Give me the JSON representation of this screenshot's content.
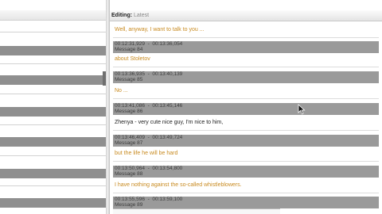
{
  "editor": {
    "header_label": "Editing:",
    "header_value": "Latest"
  },
  "lines": [
    {
      "text": "Well, anyway, I want to talk to you ..."
    },
    {
      "text": "about Stoletov"
    },
    {
      "text": "No ..."
    },
    {
      "text": "Zhenya - very cute nice guy, I'm nice to him,"
    },
    {
      "text": "but the life he will be hard"
    },
    {
      "text": "I have nothing against the so-called whistleblowers."
    }
  ],
  "entries": [
    {
      "start": "00:12:31,929",
      "end": "00:13:36,054",
      "message": "Message 84"
    },
    {
      "start": "00:13:36,935",
      "end": "00:13:40,139",
      "message": "Message 85"
    },
    {
      "start": "00:13:41,086",
      "end": "00:13:45,146",
      "message": "Message 86"
    },
    {
      "start": "00:13:46,409",
      "end": "00:13:49,724",
      "message": "Message 87"
    },
    {
      "start": "00:13:50,964",
      "end": "00:13:54,800",
      "message": "Message 88"
    },
    {
      "start": "00:13:55,596",
      "end": "00:13:59,100",
      "message": "Message 89"
    }
  ],
  "colors": {
    "dialogue_orange": "#c88a1f",
    "dialogue_dark": "#222222",
    "bar_gray": "#9a9a9a"
  },
  "icons": {
    "cursor": "mouse-pointer-icon"
  }
}
